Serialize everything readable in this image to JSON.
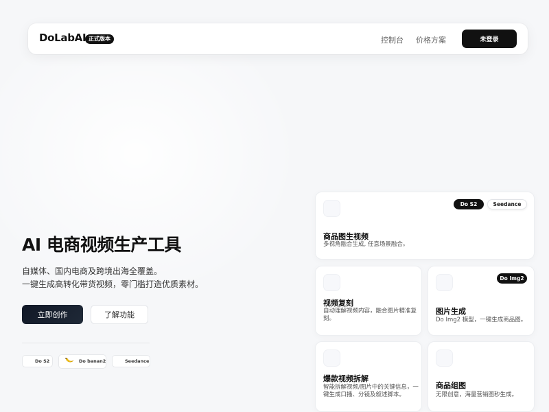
{
  "nav": {
    "brand": "DoLabAI",
    "badge": "正式版本",
    "links": [
      "控制台",
      "价格方案"
    ],
    "login_label": "未登录"
  },
  "hero": {
    "title": "AI 电商视频生产工具",
    "subtitle_1": "自媒体、国内电商及跨境出海全覆盖。",
    "subtitle_2": "一键生成高转化带货视频，零门槛打造优质素材。",
    "primary_cta": "立即创作",
    "secondary_cta": "了解功能",
    "chips": [
      "Do S2",
      "Do banan2",
      "Seedance"
    ]
  },
  "cards": [
    {
      "title": "商品图生视频",
      "desc": "多视角融合生成, 任意场景融合。",
      "tags": [
        "Do S2",
        "Seedance"
      ]
    },
    {
      "title": "视频复刻",
      "desc": "自动理解视频内容，融合图片精准复刻。"
    },
    {
      "title": "图片生成",
      "desc": "Do Img2 模型，一键生成商品图。",
      "tags": [
        "Do Img2"
      ]
    },
    {
      "title": "爆款视频拆解",
      "desc": "智能拆解视频/图片中的关键信息，一键生成口播、分镜及叙述脚本。"
    },
    {
      "title": "商品组图",
      "desc": "无限创意，海量营销图秒生成。"
    }
  ],
  "colors": {
    "accent": "#111111",
    "background": "#f6f7f9",
    "card": "#ffffff"
  }
}
